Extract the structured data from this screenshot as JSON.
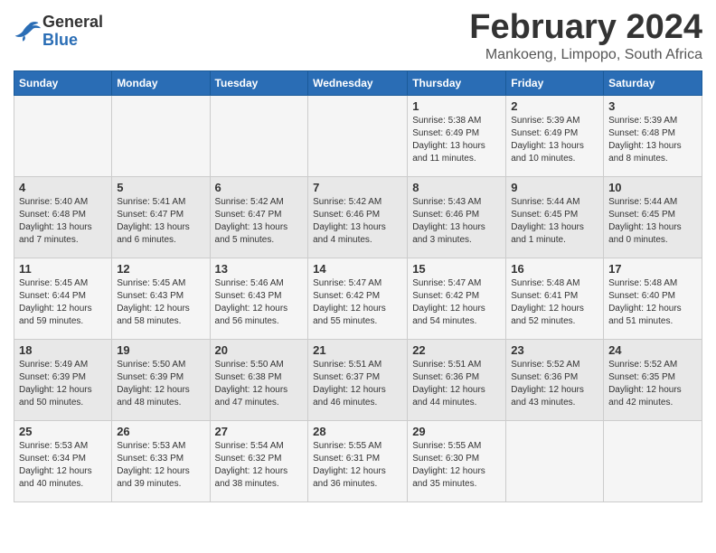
{
  "header": {
    "logo_general": "General",
    "logo_blue": "Blue",
    "month_title": "February 2024",
    "subtitle": "Mankoeng, Limpopo, South Africa"
  },
  "days_of_week": [
    "Sunday",
    "Monday",
    "Tuesday",
    "Wednesday",
    "Thursday",
    "Friday",
    "Saturday"
  ],
  "weeks": [
    [
      {
        "day": "",
        "info": ""
      },
      {
        "day": "",
        "info": ""
      },
      {
        "day": "",
        "info": ""
      },
      {
        "day": "",
        "info": ""
      },
      {
        "day": "1",
        "info": "Sunrise: 5:38 AM\nSunset: 6:49 PM\nDaylight: 13 hours\nand 11 minutes."
      },
      {
        "day": "2",
        "info": "Sunrise: 5:39 AM\nSunset: 6:49 PM\nDaylight: 13 hours\nand 10 minutes."
      },
      {
        "day": "3",
        "info": "Sunrise: 5:39 AM\nSunset: 6:48 PM\nDaylight: 13 hours\nand 8 minutes."
      }
    ],
    [
      {
        "day": "4",
        "info": "Sunrise: 5:40 AM\nSunset: 6:48 PM\nDaylight: 13 hours\nand 7 minutes."
      },
      {
        "day": "5",
        "info": "Sunrise: 5:41 AM\nSunset: 6:47 PM\nDaylight: 13 hours\nand 6 minutes."
      },
      {
        "day": "6",
        "info": "Sunrise: 5:42 AM\nSunset: 6:47 PM\nDaylight: 13 hours\nand 5 minutes."
      },
      {
        "day": "7",
        "info": "Sunrise: 5:42 AM\nSunset: 6:46 PM\nDaylight: 13 hours\nand 4 minutes."
      },
      {
        "day": "8",
        "info": "Sunrise: 5:43 AM\nSunset: 6:46 PM\nDaylight: 13 hours\nand 3 minutes."
      },
      {
        "day": "9",
        "info": "Sunrise: 5:44 AM\nSunset: 6:45 PM\nDaylight: 13 hours\nand 1 minute."
      },
      {
        "day": "10",
        "info": "Sunrise: 5:44 AM\nSunset: 6:45 PM\nDaylight: 13 hours\nand 0 minutes."
      }
    ],
    [
      {
        "day": "11",
        "info": "Sunrise: 5:45 AM\nSunset: 6:44 PM\nDaylight: 12 hours\nand 59 minutes."
      },
      {
        "day": "12",
        "info": "Sunrise: 5:45 AM\nSunset: 6:43 PM\nDaylight: 12 hours\nand 58 minutes."
      },
      {
        "day": "13",
        "info": "Sunrise: 5:46 AM\nSunset: 6:43 PM\nDaylight: 12 hours\nand 56 minutes."
      },
      {
        "day": "14",
        "info": "Sunrise: 5:47 AM\nSunset: 6:42 PM\nDaylight: 12 hours\nand 55 minutes."
      },
      {
        "day": "15",
        "info": "Sunrise: 5:47 AM\nSunset: 6:42 PM\nDaylight: 12 hours\nand 54 minutes."
      },
      {
        "day": "16",
        "info": "Sunrise: 5:48 AM\nSunset: 6:41 PM\nDaylight: 12 hours\nand 52 minutes."
      },
      {
        "day": "17",
        "info": "Sunrise: 5:48 AM\nSunset: 6:40 PM\nDaylight: 12 hours\nand 51 minutes."
      }
    ],
    [
      {
        "day": "18",
        "info": "Sunrise: 5:49 AM\nSunset: 6:39 PM\nDaylight: 12 hours\nand 50 minutes."
      },
      {
        "day": "19",
        "info": "Sunrise: 5:50 AM\nSunset: 6:39 PM\nDaylight: 12 hours\nand 48 minutes."
      },
      {
        "day": "20",
        "info": "Sunrise: 5:50 AM\nSunset: 6:38 PM\nDaylight: 12 hours\nand 47 minutes."
      },
      {
        "day": "21",
        "info": "Sunrise: 5:51 AM\nSunset: 6:37 PM\nDaylight: 12 hours\nand 46 minutes."
      },
      {
        "day": "22",
        "info": "Sunrise: 5:51 AM\nSunset: 6:36 PM\nDaylight: 12 hours\nand 44 minutes."
      },
      {
        "day": "23",
        "info": "Sunrise: 5:52 AM\nSunset: 6:36 PM\nDaylight: 12 hours\nand 43 minutes."
      },
      {
        "day": "24",
        "info": "Sunrise: 5:52 AM\nSunset: 6:35 PM\nDaylight: 12 hours\nand 42 minutes."
      }
    ],
    [
      {
        "day": "25",
        "info": "Sunrise: 5:53 AM\nSunset: 6:34 PM\nDaylight: 12 hours\nand 40 minutes."
      },
      {
        "day": "26",
        "info": "Sunrise: 5:53 AM\nSunset: 6:33 PM\nDaylight: 12 hours\nand 39 minutes."
      },
      {
        "day": "27",
        "info": "Sunrise: 5:54 AM\nSunset: 6:32 PM\nDaylight: 12 hours\nand 38 minutes."
      },
      {
        "day": "28",
        "info": "Sunrise: 5:55 AM\nSunset: 6:31 PM\nDaylight: 12 hours\nand 36 minutes."
      },
      {
        "day": "29",
        "info": "Sunrise: 5:55 AM\nSunset: 6:30 PM\nDaylight: 12 hours\nand 35 minutes."
      },
      {
        "day": "",
        "info": ""
      },
      {
        "day": "",
        "info": ""
      }
    ]
  ]
}
